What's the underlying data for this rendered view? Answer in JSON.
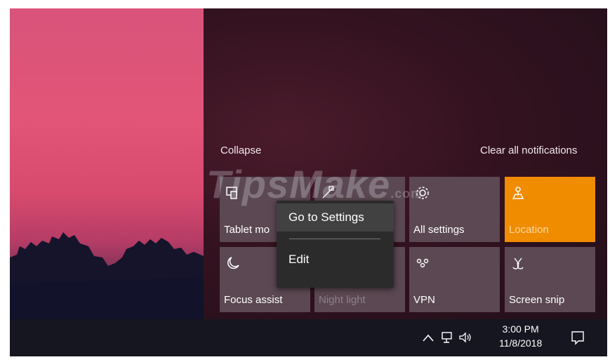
{
  "action_center": {
    "collapse_label": "Collapse",
    "clear_all_label": "Clear all notifications",
    "tiles": [
      {
        "label": "Tablet mo",
        "icon": "tablet-mode-icon",
        "active": false
      },
      {
        "label": "",
        "icon": "network-icon",
        "active": false
      },
      {
        "label": "All settings",
        "icon": "gear-icon",
        "active": false
      },
      {
        "label": "Location",
        "icon": "location-icon",
        "active": true
      },
      {
        "label": "Focus assist",
        "icon": "moon-icon",
        "active": false
      },
      {
        "label": "Night light",
        "icon": "night-light-icon",
        "active": false
      },
      {
        "label": "VPN",
        "icon": "vpn-icon",
        "active": false
      },
      {
        "label": "Screen snip",
        "icon": "screen-snip-icon",
        "active": false
      }
    ],
    "accent_color": "#f08c00"
  },
  "context_menu": {
    "items": [
      {
        "label": "Go to Settings"
      },
      {
        "label": "Edit"
      }
    ]
  },
  "taskbar": {
    "time": "3:00 PM",
    "date": "11/8/2018"
  },
  "watermark": {
    "text": "TipsMake",
    "suffix": ".com"
  }
}
